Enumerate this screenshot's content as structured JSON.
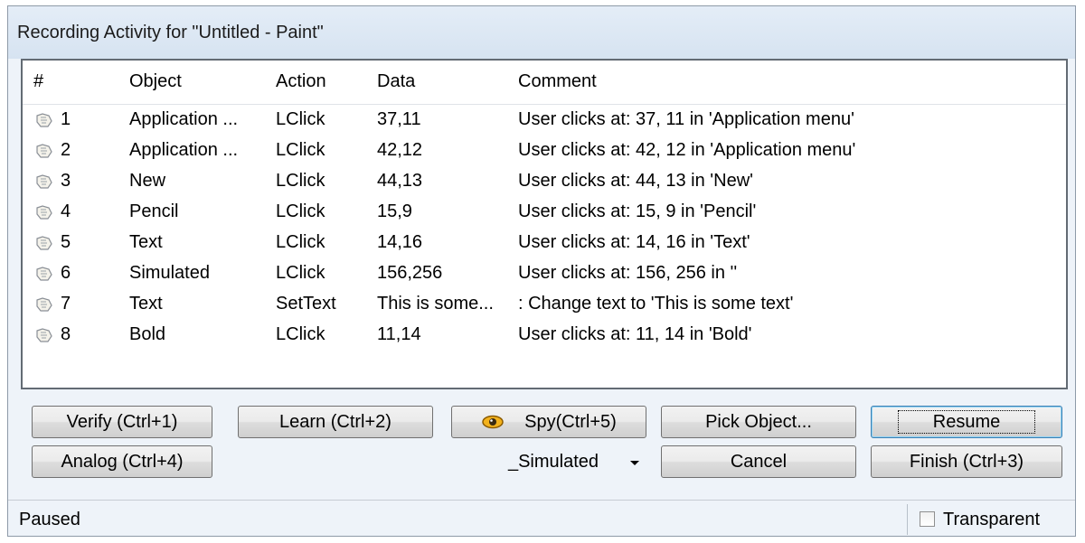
{
  "window": {
    "title": "Recording Activity for \"Untitled - Paint\""
  },
  "list": {
    "columns": [
      "#",
      "Object",
      "Action",
      "Data",
      "Comment"
    ],
    "rows": [
      {
        "num": "1",
        "object": "Application ...",
        "action": "LClick",
        "data": "37,11",
        "comment": "User clicks at: 37, 11 in 'Application menu'"
      },
      {
        "num": "2",
        "object": "Application ...",
        "action": "LClick",
        "data": "42,12",
        "comment": "User clicks at: 42, 12 in 'Application menu'"
      },
      {
        "num": "3",
        "object": "New",
        "action": "LClick",
        "data": "44,13",
        "comment": "User clicks at: 44, 13 in 'New'"
      },
      {
        "num": "4",
        "object": "Pencil",
        "action": "LClick",
        "data": "15,9",
        "comment": "User clicks at: 15, 9 in 'Pencil'"
      },
      {
        "num": "5",
        "object": "Text",
        "action": "LClick",
        "data": "14,16",
        "comment": "User clicks at: 14, 16 in 'Text'"
      },
      {
        "num": "6",
        "object": "Simulated",
        "action": "LClick",
        "data": "156,256",
        "comment": "User clicks at: 156, 256 in ''"
      },
      {
        "num": "7",
        "object": "Text",
        "action": "SetText",
        "data": "This is some...",
        "comment": ": Change text to 'This is some text'"
      },
      {
        "num": "8",
        "object": "Bold",
        "action": "LClick",
        "data": "11,14",
        "comment": "User clicks at: 11, 14 in 'Bold'"
      }
    ],
    "row_icon": "hand-pointer-icon"
  },
  "buttons": {
    "verify": "Verify (Ctrl+1)",
    "learn": "Learn (Ctrl+2)",
    "spy": "Spy(Ctrl+5)",
    "spy_icon": "eye-icon",
    "pick": "Pick Object...",
    "resume": "Resume",
    "analog": "Analog (Ctrl+4)",
    "cancel": "Cancel",
    "finish": "Finish (Ctrl+3)"
  },
  "mode_select": {
    "value": "_Simulated"
  },
  "status": {
    "text": "Paused",
    "transparent_label": "Transparent",
    "transparent_checked": false
  }
}
